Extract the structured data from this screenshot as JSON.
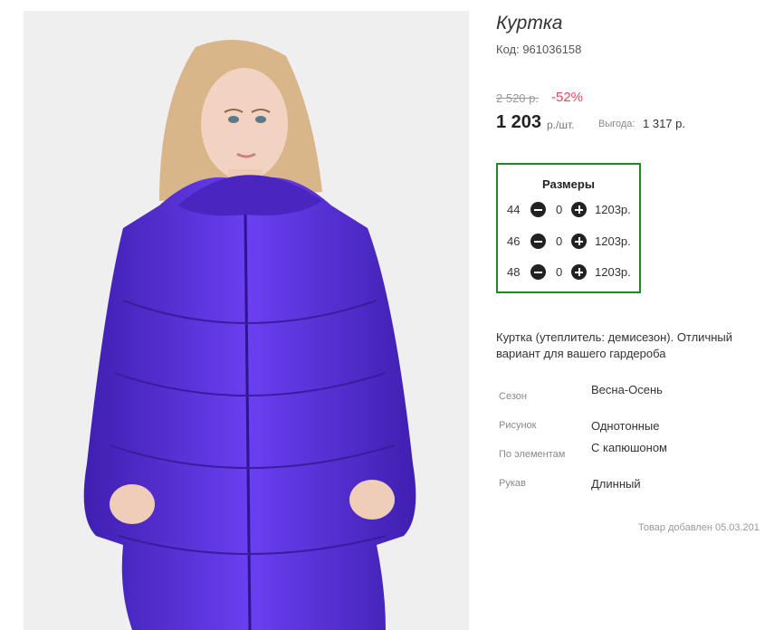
{
  "product": {
    "title": "Куртка",
    "code": "Код: 961036158",
    "old_price": "2 520 р.",
    "discount": "-52%",
    "price": "1 203",
    "price_unit": "р./шт.",
    "savings_label": "Выгода:",
    "savings_value": "1 317 р."
  },
  "sizes": {
    "title": "Размеры",
    "rows": [
      {
        "size": "44",
        "qty": "0",
        "price": "1203р."
      },
      {
        "size": "46",
        "qty": "0",
        "price": "1203р."
      },
      {
        "size": "48",
        "qty": "0",
        "price": "1203р."
      }
    ]
  },
  "description": "Куртка (утеплитель: демисезон). Отличный вариант для вашего гардероба",
  "attributes": [
    {
      "label": "Сезон",
      "value": "Весна-Осень"
    },
    {
      "label": "Рисунок",
      "value": "Однотонные"
    },
    {
      "label": "По элементам",
      "value": "С капюшоном"
    },
    {
      "label": "Рукав",
      "value": "Длинный"
    }
  ],
  "added_date": "Товар добавлен 05.03.201",
  "colors": {
    "discount": "#e0485e",
    "sizes_border": "#1f8a1f",
    "jacket": "#5a2fd1"
  }
}
